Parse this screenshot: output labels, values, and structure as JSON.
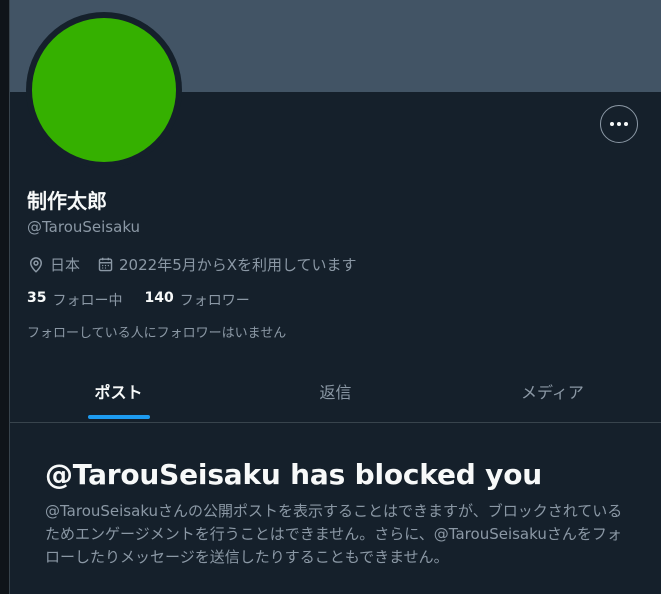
{
  "profile": {
    "display_name": "制作太郎",
    "handle": "@TarouSeisaku",
    "location": "日本",
    "joined": "2022年5月からXを利用しています",
    "following_count": "35",
    "following_label": "フォロー中",
    "followers_count": "140",
    "followers_label": "フォロワー",
    "followers_note": "フォローしている人にフォロワーはいません",
    "avatar_color": "#35b000",
    "banner_color": "#425465"
  },
  "tabs": [
    {
      "label": "ポスト",
      "active": true
    },
    {
      "label": "返信",
      "active": false
    },
    {
      "label": "メディア",
      "active": false
    }
  ],
  "blocked": {
    "title": "@TarouSeisaku has blocked you",
    "description": "@TarouSeisakuさんの公開ポストを表示することはできますが、ブロックされているためエンゲージメントを行うことはできません。さらに、@TarouSeisakuさんをフォローしたりメッセージを送信したりすることもできません。"
  },
  "icons": {
    "more": "more-horizontal-icon",
    "location": "location-pin-icon",
    "calendar": "calendar-icon"
  },
  "colors": {
    "background": "#15202b",
    "accent": "#1d9bf0",
    "secondary_text": "#8b98a5"
  }
}
